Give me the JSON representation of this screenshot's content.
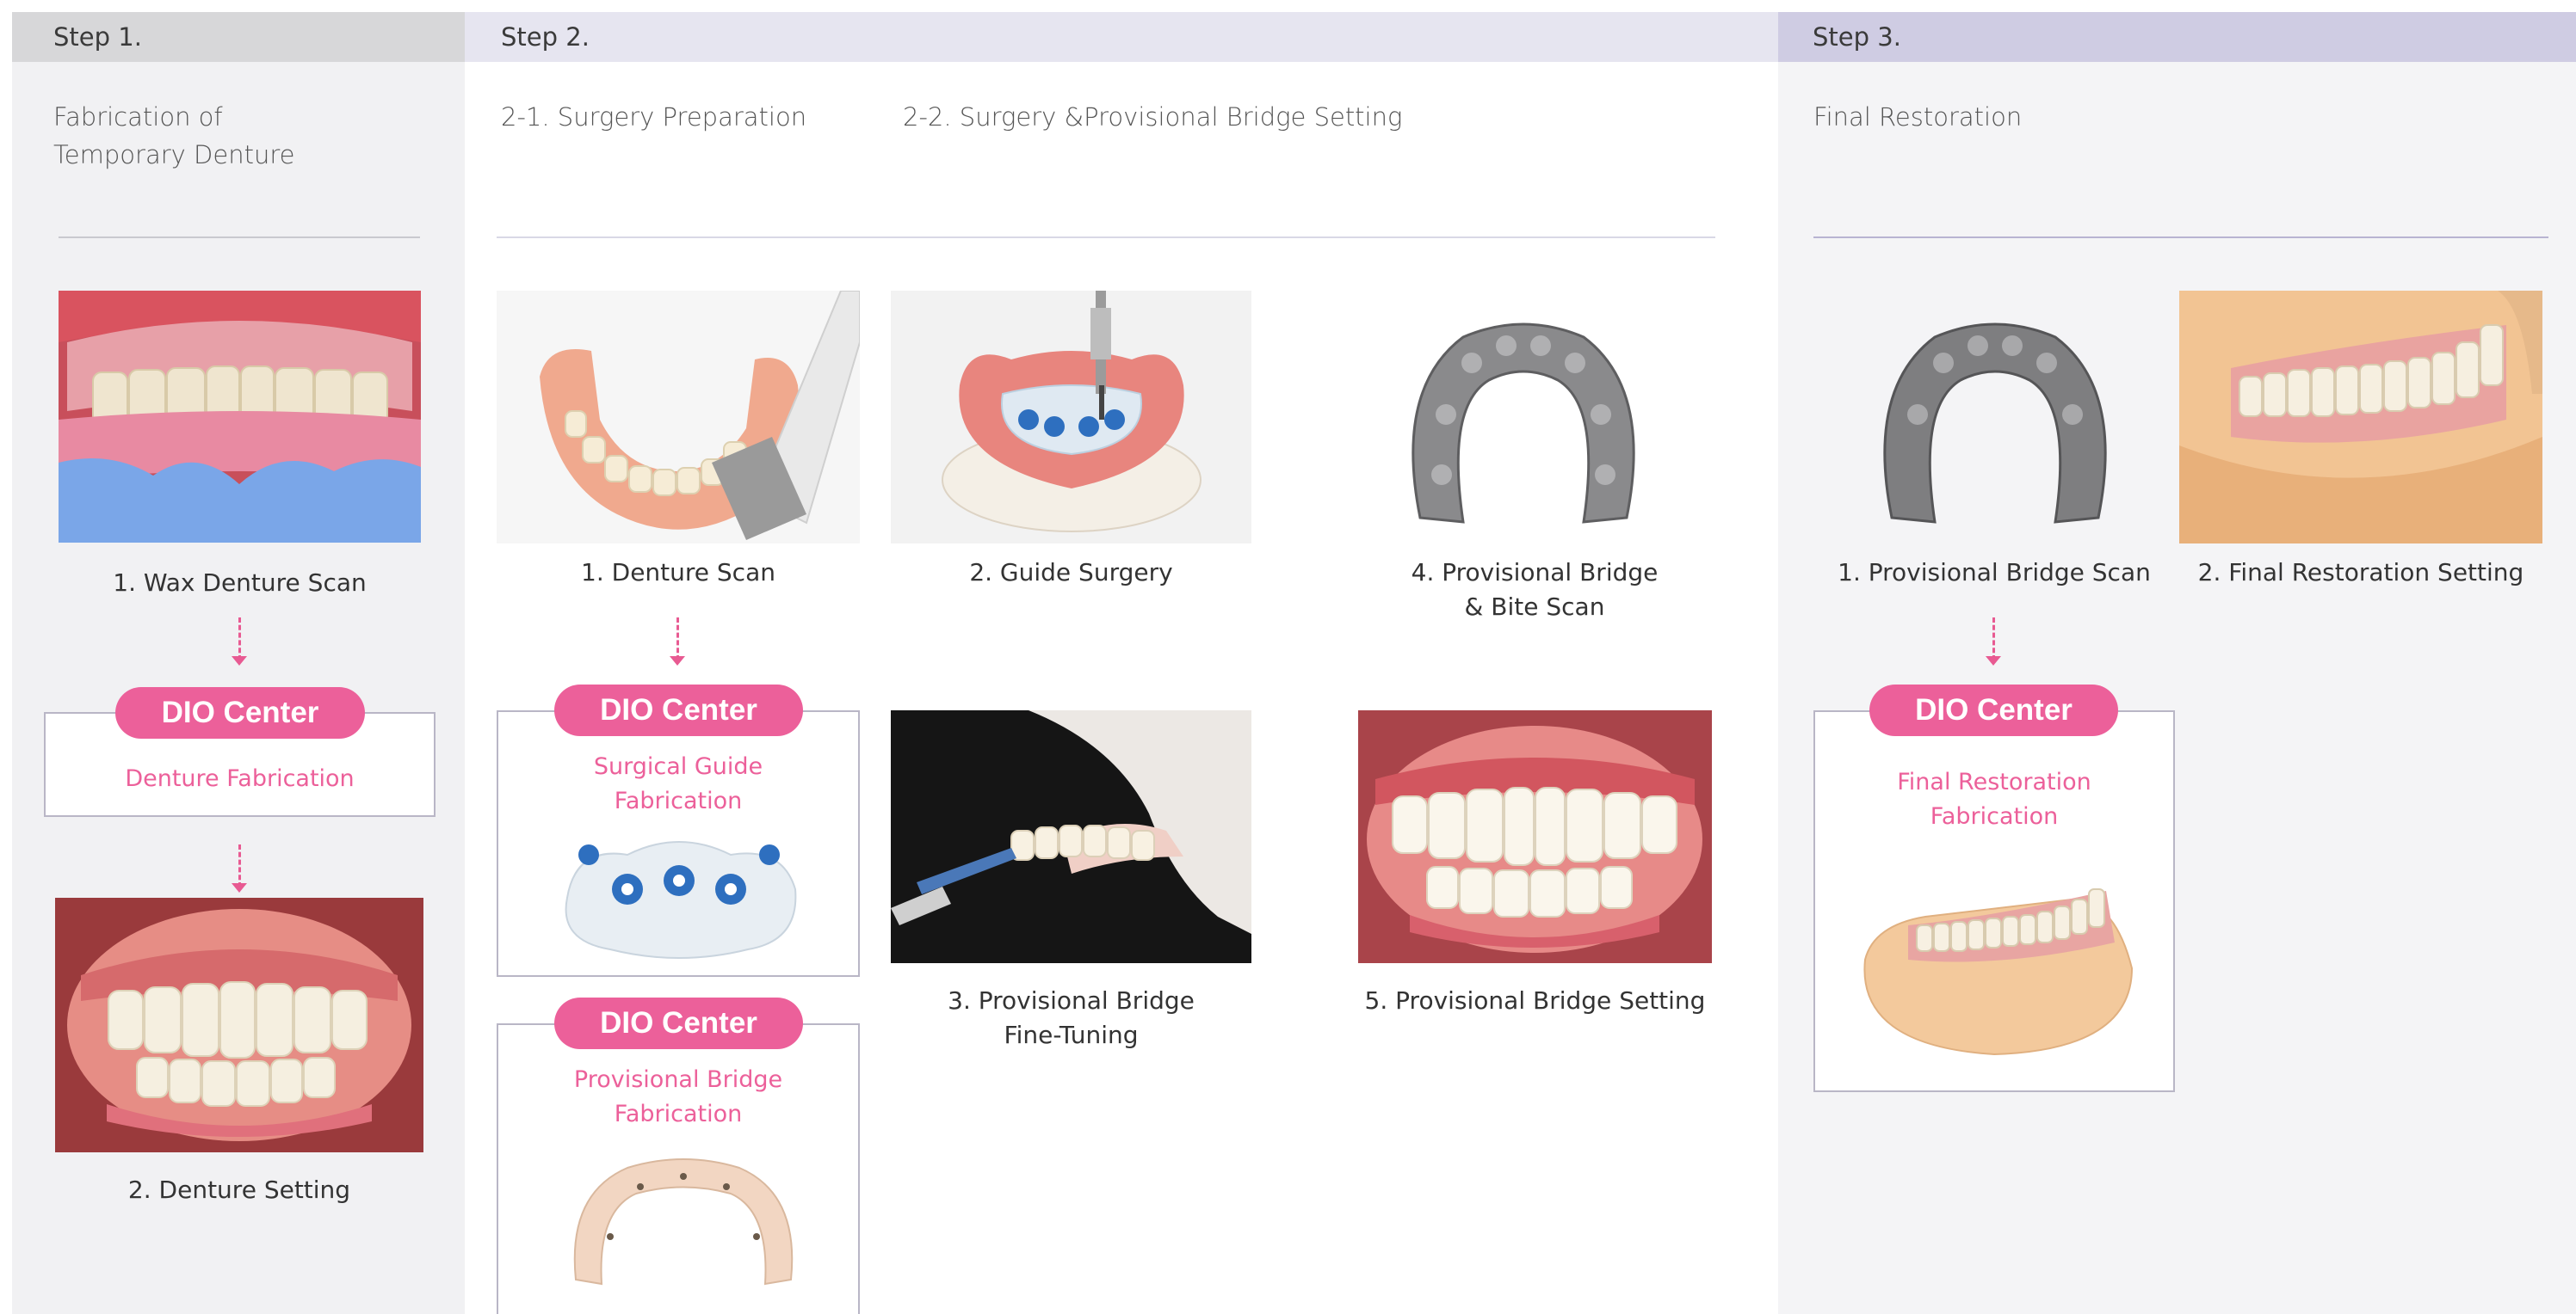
{
  "step1": {
    "header": "Step 1.",
    "subtitle_line1": "Fabrication of",
    "subtitle_line2": "Temporary Denture",
    "caption_wax_denture_scan": "1. Wax Denture Scan",
    "dio_center_label": "DIO Center",
    "dio_center_text": "Denture Fabrication",
    "caption_denture_setting": "2. Denture Setting"
  },
  "step2": {
    "header": "Step 2.",
    "subtitle_surgery_prep": "2-1. Surgery Preparation",
    "subtitle_surgery_bridge": "2-2. Surgery &Provisional Bridge Setting",
    "caption_denture_scan": "1. Denture Scan",
    "caption_guide_surgery": "2. Guide Surgery",
    "caption_bite_scan_line1": "4. Provisional Bridge",
    "caption_bite_scan_line2": "& Bite Scan",
    "caption_fine_tuning_line1": "3. Provisional Bridge",
    "caption_fine_tuning_line2": "Fine-Tuning",
    "caption_bridge_setting": "5. Provisional Bridge Setting",
    "dio_guide_label": "DIO Center",
    "dio_guide_line1": "Surgical Guide",
    "dio_guide_line2": "Fabrication",
    "dio_bridge_label": "DIO Center",
    "dio_bridge_line1": "Provisional Bridge",
    "dio_bridge_line2": "Fabrication"
  },
  "step3": {
    "header": "Step 3.",
    "subtitle": "Final Restoration",
    "caption_bridge_scan": "1. Provisional Bridge Scan",
    "caption_final_setting": "2. Final Restoration Setting",
    "dio_center_label": "DIO Center",
    "dio_center_line1": "Final Restoration",
    "dio_center_line2": "Fabrication"
  },
  "colors": {
    "accent_pink": "#ec609a",
    "step1_bg": "#f1f1f3",
    "step1_header": "#d7d7d9",
    "step2_header": "#e6e5f0",
    "step3_bg": "#f4f4f6",
    "step3_header": "#cfcce3"
  }
}
